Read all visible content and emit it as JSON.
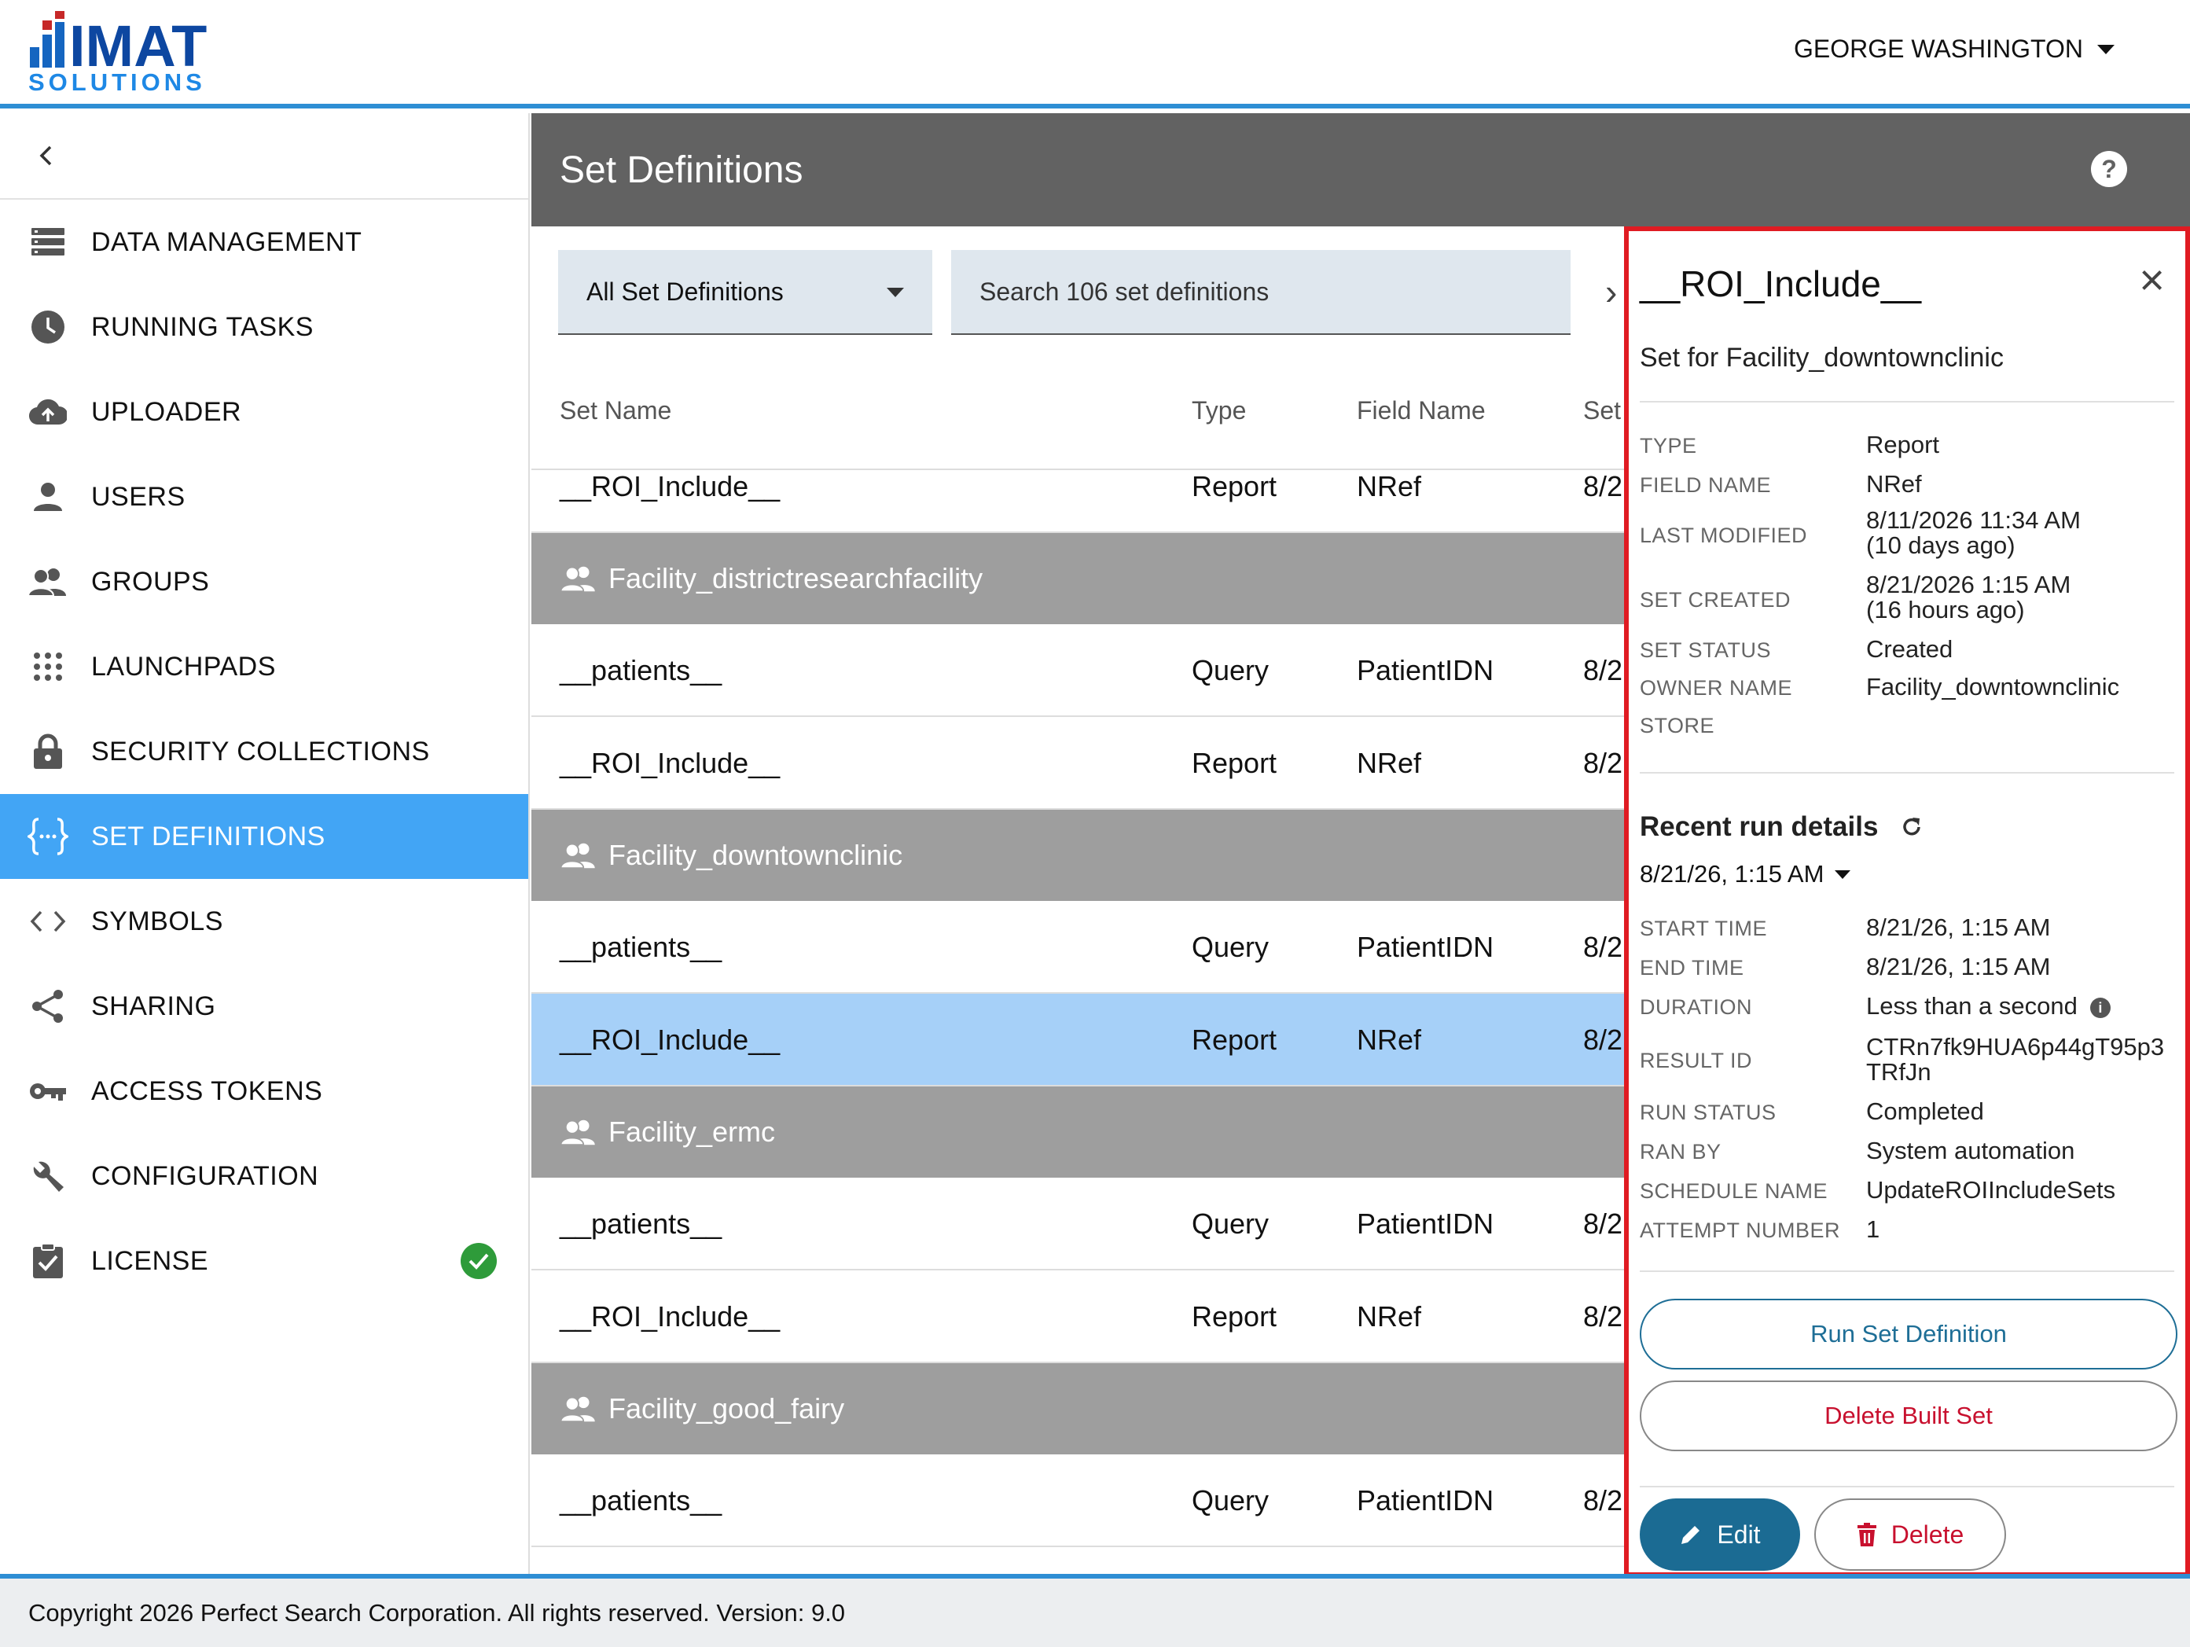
{
  "header": {
    "logo_text": "IMAT",
    "logo_subtext": "SOLUTIONS",
    "user_name": "GEORGE WASHINGTON"
  },
  "sidebar": {
    "items": [
      {
        "label": "DATA MANAGEMENT",
        "icon": "data-management-icon"
      },
      {
        "label": "RUNNING TASKS",
        "icon": "clock-icon"
      },
      {
        "label": "UPLOADER",
        "icon": "cloud-upload-icon"
      },
      {
        "label": "USERS",
        "icon": "user-icon"
      },
      {
        "label": "GROUPS",
        "icon": "group-icon"
      },
      {
        "label": "LAUNCHPADS",
        "icon": "apps-grid-icon"
      },
      {
        "label": "SECURITY COLLECTIONS",
        "icon": "lock-icon"
      },
      {
        "label": "SET DEFINITIONS",
        "icon": "curly-braces-icon",
        "active": true
      },
      {
        "label": "SYMBOLS",
        "icon": "code-icon"
      },
      {
        "label": "SHARING",
        "icon": "share-icon"
      },
      {
        "label": "ACCESS TOKENS",
        "icon": "key-icon"
      },
      {
        "label": "CONFIGURATION",
        "icon": "wrench-icon"
      },
      {
        "label": "LICENSE",
        "icon": "clipboard-check-icon",
        "status": "check-circle-icon"
      }
    ]
  },
  "main": {
    "title": "Set Definitions",
    "filter_label": "All Set Definitions",
    "search_placeholder": "Search 106 set definitions",
    "columns": [
      "Set Name",
      "Type",
      "Field Name",
      "Set"
    ],
    "first_row": {
      "name": "__ROI_Include__",
      "type": "Report",
      "field": "NRef",
      "date": "8/2"
    },
    "groups": [
      {
        "name": "Facility_districtresearchfacility",
        "rows": [
          {
            "name": "__patients__",
            "type": "Query",
            "field": "PatientIDN",
            "date": "8/2"
          },
          {
            "name": "__ROI_Include__",
            "type": "Report",
            "field": "NRef",
            "date": "8/2"
          }
        ]
      },
      {
        "name": "Facility_downtownclinic",
        "rows": [
          {
            "name": "__patients__",
            "type": "Query",
            "field": "PatientIDN",
            "date": "8/2"
          },
          {
            "name": "__ROI_Include__",
            "type": "Report",
            "field": "NRef",
            "date": "8/2"
          }
        ]
      },
      {
        "name": "Facility_ermc",
        "rows": [
          {
            "name": "__patients__",
            "type": "Query",
            "field": "PatientIDN",
            "date": "8/2"
          },
          {
            "name": "__ROI_Include__",
            "type": "Report",
            "field": "NRef",
            "date": "8/2"
          }
        ]
      },
      {
        "name": "Facility_good_fairy",
        "rows": [
          {
            "name": "__patients__",
            "type": "Query",
            "field": "PatientIDN",
            "date": "8/2"
          }
        ]
      }
    ]
  },
  "panel": {
    "title": "__ROI_Include__",
    "subtitle": "Set for Facility_downtownclinic",
    "details": {
      "type_label": "TYPE",
      "type_value": "Report",
      "field_label": "FIELD NAME",
      "field_value": "NRef",
      "modified_label": "LAST MODIFIED",
      "modified_value": "8/11/2026 11:34 AM",
      "modified_ago": "(10 days ago)",
      "created_label": "SET CREATED",
      "created_value": "8/21/2026 1:15 AM",
      "created_ago": "(16 hours ago)",
      "status_label": "SET STATUS",
      "status_value": "Created",
      "owner_label": "OWNER NAME",
      "owner_value": "Facility_downtownclinic",
      "store_label": "STORE",
      "store_value": ""
    },
    "recent_heading": "Recent run details",
    "recent_date": "8/21/26, 1:15 AM",
    "run": {
      "start_label": "START TIME",
      "start_value": "8/21/26, 1:15 AM",
      "end_label": "END TIME",
      "end_value": "8/21/26, 1:15 AM",
      "duration_label": "DURATION",
      "duration_value": "Less than a second",
      "result_label": "RESULT ID",
      "result_value_1": "CTRn7fk9HUA6p44gT95p3",
      "result_value_2": "TRfJn",
      "runstatus_label": "RUN STATUS",
      "runstatus_value": "Completed",
      "ranby_label": "RAN BY",
      "ranby_value": "System automation",
      "schedule_label": "SCHEDULE NAME",
      "schedule_value": "UpdateROIIncludeSets",
      "attempt_label": "ATTEMPT NUMBER",
      "attempt_value": "1"
    },
    "run_button": "Run Set Definition",
    "delete_built_button": "Delete Built Set",
    "edit_button": "Edit",
    "delete_button": "Delete"
  },
  "footer": {
    "text": "Copyright 2026 Perfect Search Corporation. All rights reserved. Version: 9.0"
  },
  "colors": {
    "accent": "#42a5f5",
    "header_border": "#2e8ed4",
    "highlight_border": "#e01b22",
    "edit_button": "#1b6b93",
    "group_row": "#9e9e9e",
    "selected_row": "#a6d0f8"
  }
}
